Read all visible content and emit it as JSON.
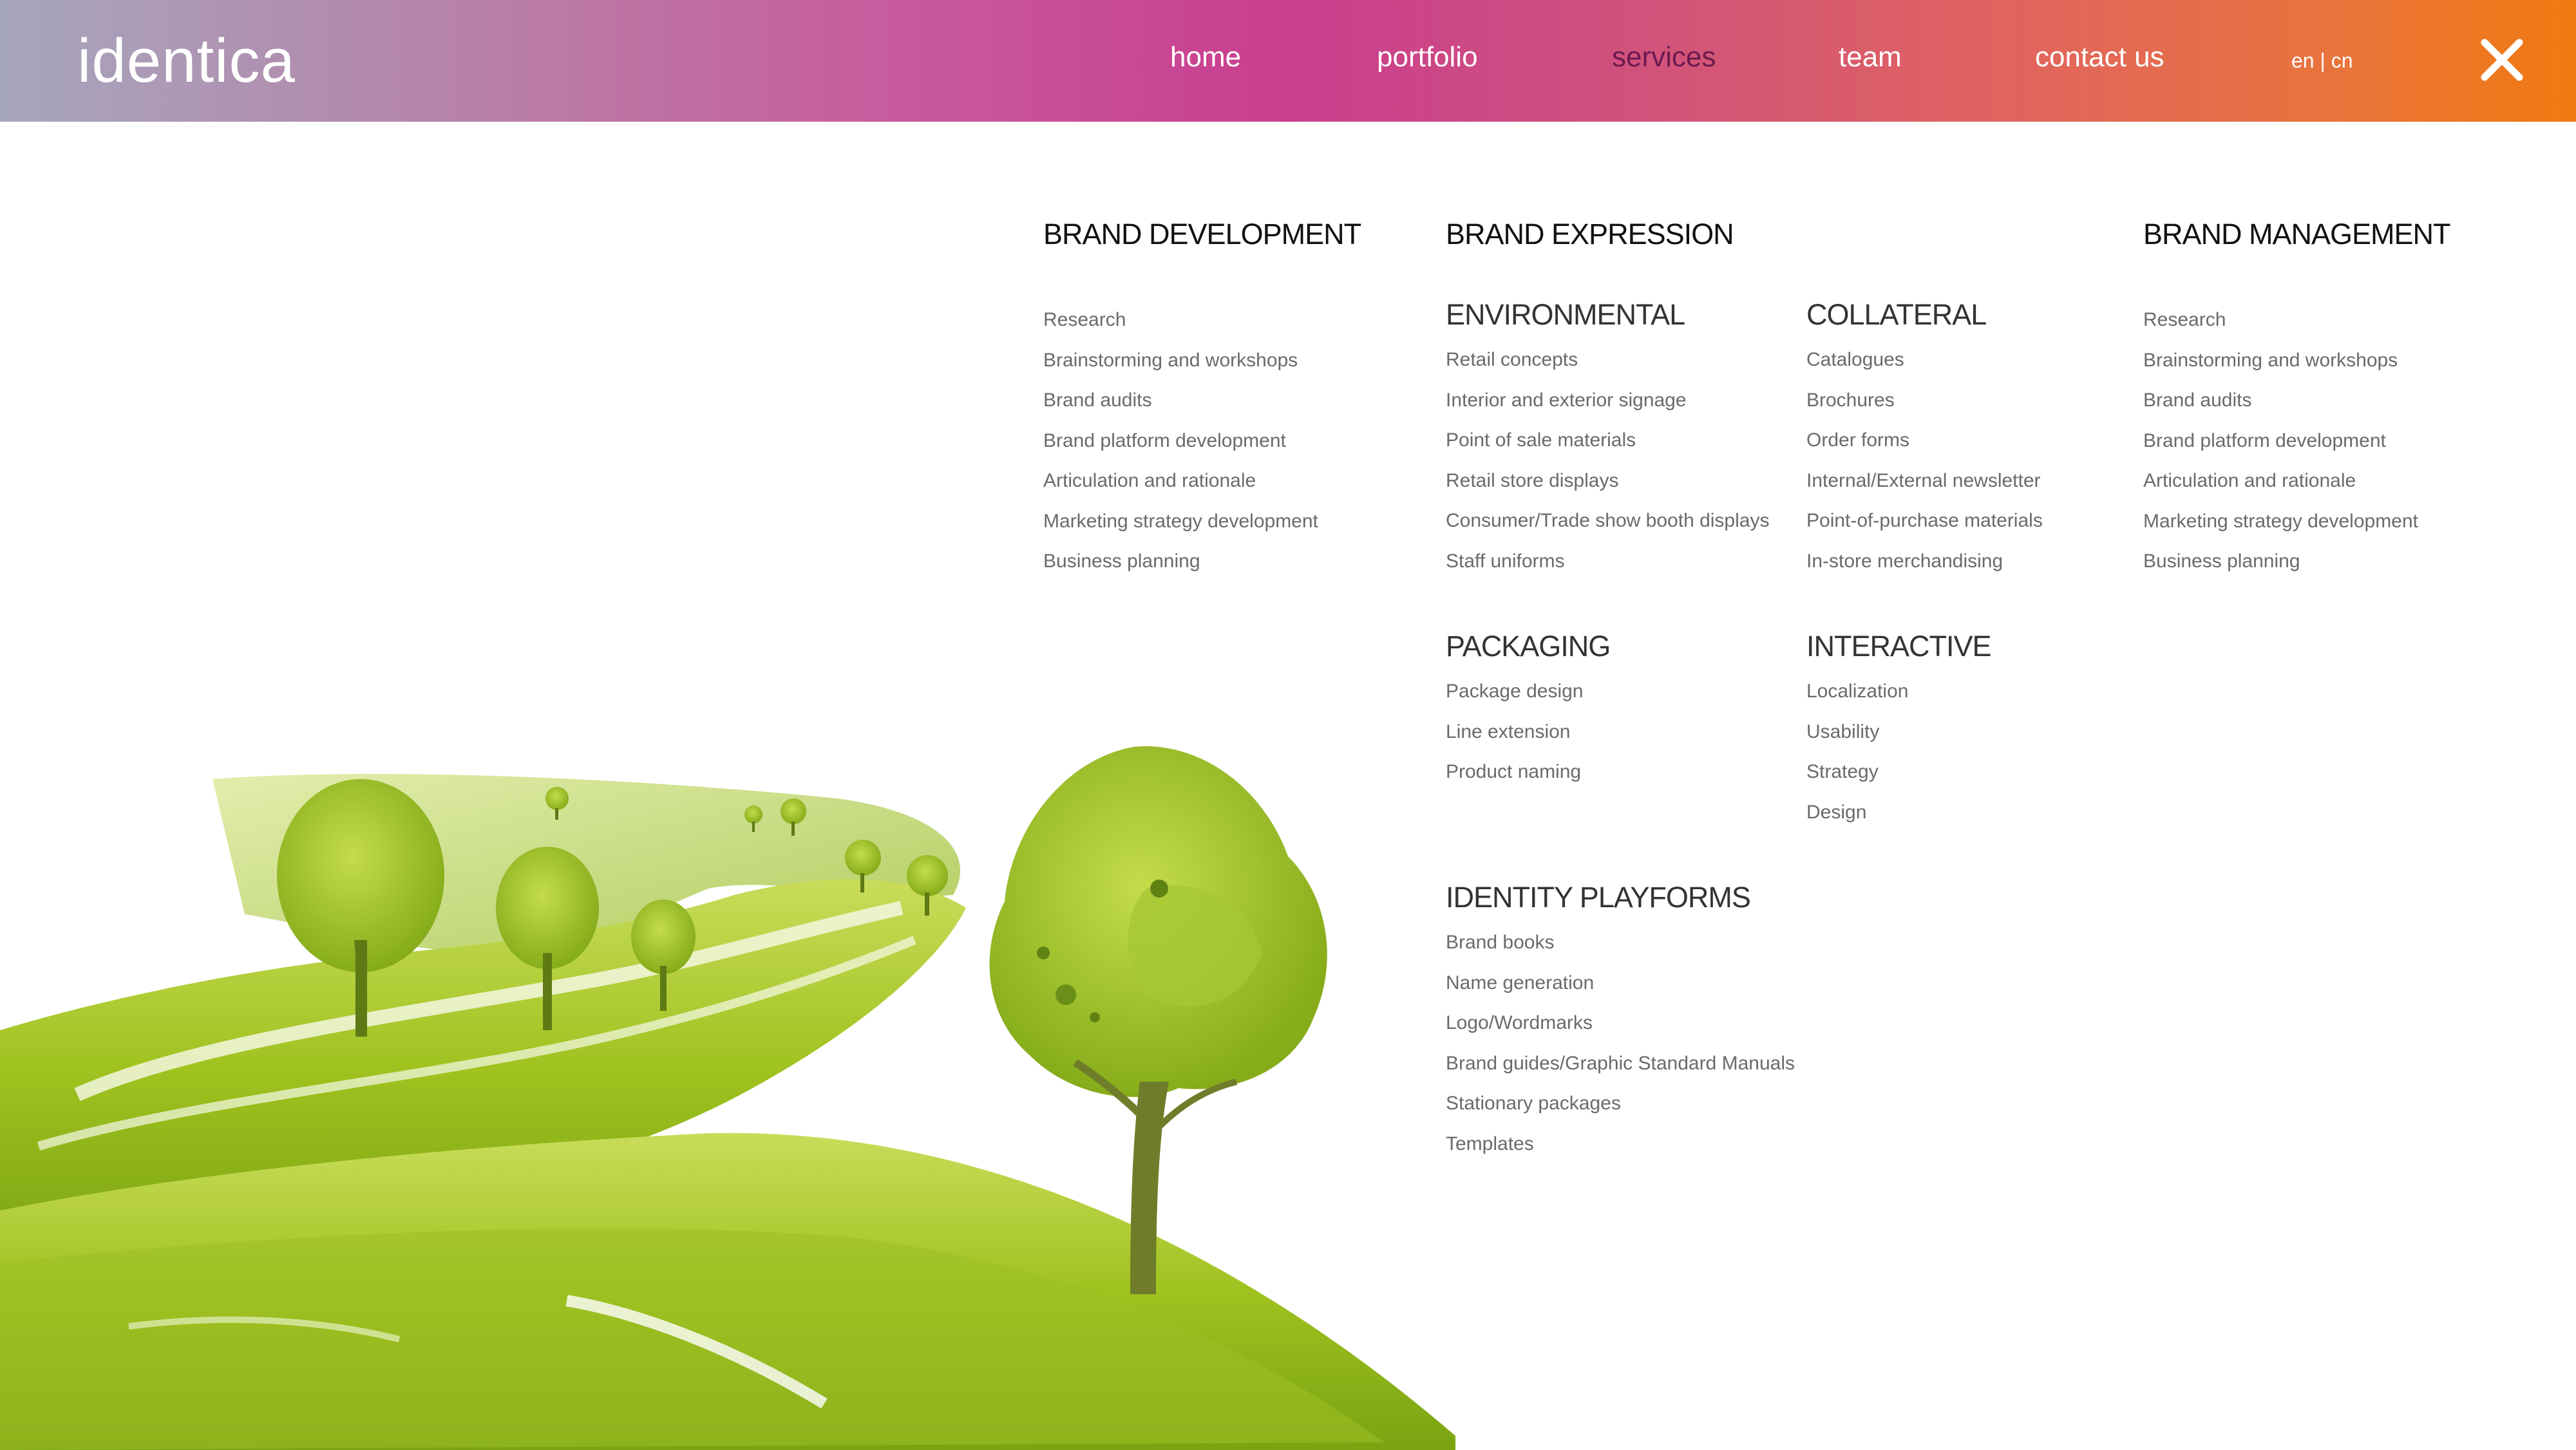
{
  "header": {
    "logo": "identica",
    "nav": [
      {
        "label": "home"
      },
      {
        "label": "portfolio"
      },
      {
        "label": "services",
        "active": true
      },
      {
        "label": "team"
      },
      {
        "label": "contact us"
      }
    ],
    "lang": {
      "en": "en",
      "separator": "|",
      "cn": "cn"
    },
    "close_icon": "close-icon",
    "gradient": [
      "#a6a6bd",
      "#c93e8e",
      "#f07a10"
    ],
    "active_color": "#6b1a4f"
  },
  "brand_development": {
    "title": "BRAND DEVELOPMENT",
    "items": [
      "Research",
      "Brainstorming and workshops",
      "Brand audits",
      "Brand platform development",
      "Articulation and rationale",
      "Marketing strategy development",
      "Business planning"
    ]
  },
  "brand_expression": {
    "title": "BRAND EXPRESSION",
    "environmental": {
      "title": "ENVIRONMENTAL",
      "items": [
        "Retail concepts",
        "Interior and exterior signage",
        "Point of sale materials",
        "Retail store displays",
        "Consumer/Trade show booth displays",
        "Staff uniforms"
      ]
    },
    "collateral": {
      "title": "COLLATERAL",
      "items": [
        "Catalogues",
        "Brochures",
        "Order forms",
        "Internal/External newsletter",
        "Point-of-purchase materials",
        "In-store merchandising"
      ]
    },
    "packaging": {
      "title": "PACKAGING",
      "items": [
        "Package design",
        "Line extension",
        "Product naming"
      ]
    },
    "interactive": {
      "title": "INTERACTIVE",
      "items": [
        "Localization",
        "Usability",
        "Strategy",
        "Design"
      ]
    },
    "identity": {
      "title": "IDENTITY PLAYFORMS",
      "items": [
        "Brand books",
        "Name generation",
        "Logo/Wordmarks",
        "Brand guides/Graphic Standard Manuals",
        "Stationary packages",
        "Templates"
      ]
    }
  },
  "brand_management": {
    "title": "BRAND MANAGEMENT",
    "items": [
      "Research",
      "Brainstorming and workshops",
      "Brand audits",
      "Brand platform development",
      "Articulation and rationale",
      "Marketing strategy development",
      "Business planning"
    ]
  }
}
